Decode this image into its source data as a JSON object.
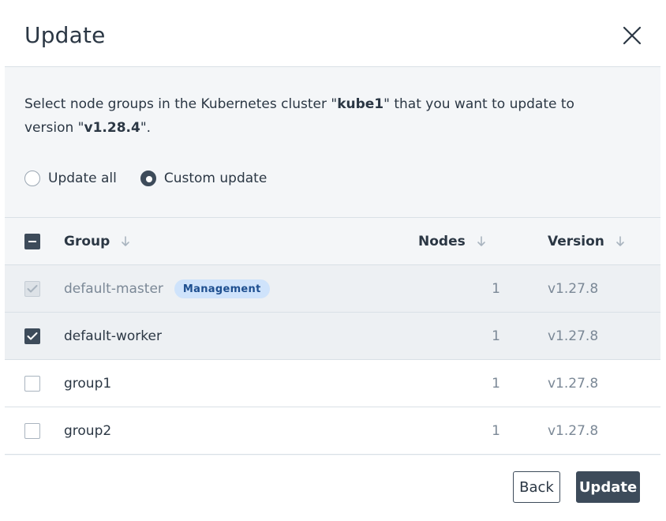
{
  "dialog": {
    "title": "Update",
    "description": {
      "prefix": "Select node groups in the Kubernetes cluster \"",
      "cluster": "kube1",
      "middle": "\" that you want to update to version \"",
      "version": "v1.28.4",
      "suffix": "\"."
    },
    "radio_options": [
      {
        "label": "Update all",
        "checked": false
      },
      {
        "label": "Custom update",
        "checked": true
      }
    ],
    "table": {
      "columns": [
        "Group",
        "Nodes",
        "Version"
      ],
      "rows": [
        {
          "group": "default-master",
          "badge": "Management",
          "nodes": "1",
          "version": "v1.27.8",
          "state": "disabled-checked"
        },
        {
          "group": "default-worker",
          "badge": "",
          "nodes": "1",
          "version": "v1.27.8",
          "state": "checked"
        },
        {
          "group": "group1",
          "badge": "",
          "nodes": "1",
          "version": "v1.27.8",
          "state": "unchecked"
        },
        {
          "group": "group2",
          "badge": "",
          "nodes": "1",
          "version": "v1.27.8",
          "state": "unchecked"
        }
      ]
    },
    "buttons": {
      "back": "Back",
      "update": "Update"
    }
  },
  "colors": {
    "primary": "#3d4b5a",
    "badge_bg": "#cfe3fb",
    "badge_text": "#1e4f8f",
    "panel_bg": "#f4f6f8"
  }
}
